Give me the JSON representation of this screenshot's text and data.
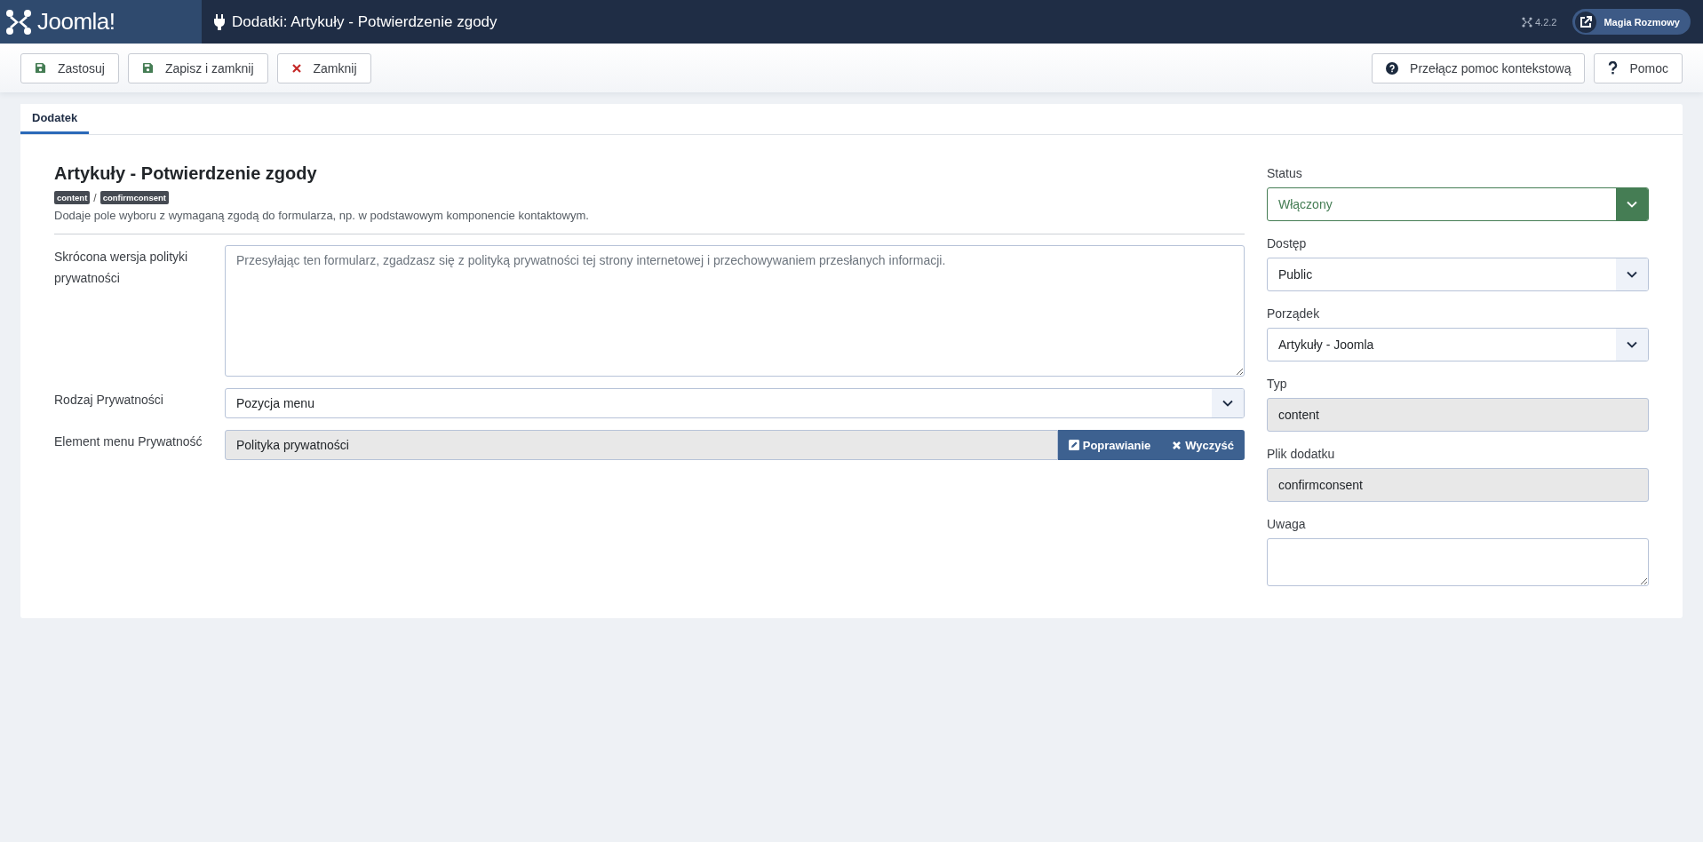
{
  "header": {
    "logo": "Joomla!",
    "title": "Dodatki: Artykuły - Potwierdzenie zgody",
    "version": "4.2.2",
    "site_button": "Magia Rozmowy"
  },
  "toolbar": {
    "left": [
      {
        "label": "Zastosuj",
        "kind": "save"
      },
      {
        "label": "Zapisz i zamknij",
        "kind": "save"
      },
      {
        "label": "Zamknij",
        "kind": "close"
      }
    ],
    "right": [
      {
        "label": "Przełącz pomoc kontekstową",
        "kind": "help"
      },
      {
        "label": "Pomoc",
        "kind": "question"
      }
    ]
  },
  "tabs": [
    {
      "label": "Dodatek",
      "selected": true
    }
  ],
  "plugin": {
    "title": "Artykuły - Potwierdzenie zgody",
    "badges": [
      "content",
      "confirmconsent"
    ],
    "separator": "/",
    "description": "Dodaje pole wyboru z wymaganą zgodą do formularza, np. w podstawowym komponencie kontaktowym."
  },
  "fields": [
    {
      "kind": "textarea",
      "label": "Skrócona wersja polityki prywatności",
      "placeholder": "Przesyłając ten formularz, zgadzasz się z polityką prywatności tej strony internetowej i przechowywaniem przesłanych informacji."
    },
    {
      "kind": "select",
      "label": "Rodzaj Prywatności",
      "value": "Pozycja menu"
    },
    {
      "kind": "modal",
      "label": "Element menu Prywatność",
      "value": "Polityka prywatności",
      "buttons": [
        {
          "label": "Poprawianie",
          "kind": "edit"
        },
        {
          "label": "Wyczyść",
          "kind": "clear"
        }
      ]
    }
  ],
  "sidebar": [
    {
      "kind": "status",
      "label": "Status",
      "value": "Włączony"
    },
    {
      "kind": "select",
      "label": "Dostęp",
      "value": "Public"
    },
    {
      "kind": "select",
      "label": "Porządek",
      "value": "Artykuły - Joomla"
    },
    {
      "kind": "readonly",
      "label": "Typ",
      "value": "content"
    },
    {
      "kind": "readonly",
      "label": "Plik dodatku",
      "value": "confirmconsent"
    },
    {
      "kind": "textarea",
      "label": "Uwaga"
    }
  ]
}
